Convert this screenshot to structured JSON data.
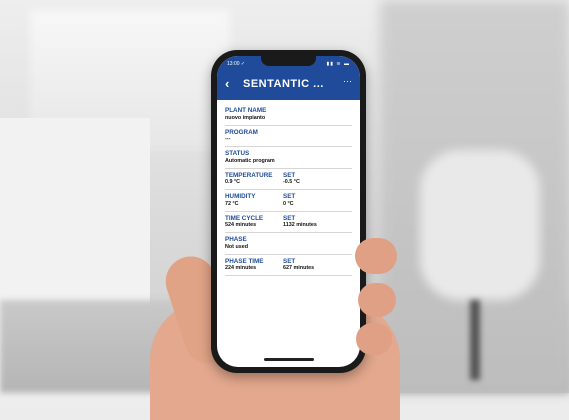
{
  "status_bar": {
    "time": "13:00 ✓",
    "icons": "▮▮ ≋ ▬"
  },
  "header": {
    "back_icon": "back-chevron-icon",
    "title": "SENTANTIC ...",
    "menu_icon": "more-icon"
  },
  "fields": {
    "plant_name": {
      "label": "PLANT NAME",
      "value": "nuovo impianto"
    },
    "program": {
      "label": "PROGRAM",
      "value": "---"
    },
    "status": {
      "label": "STATUS",
      "value": "Automatic program"
    },
    "temperature": {
      "label": "TEMPERATURE",
      "value": "0.9 °C",
      "set_label": "SET",
      "set_value": "-0.5 °C"
    },
    "humidity": {
      "label": "HUMIDITY",
      "value": "72 °C",
      "set_label": "SET",
      "set_value": "0 °C"
    },
    "time_cycle": {
      "label": "TIME CYCLE",
      "value": "524 minutes",
      "set_label": "SET",
      "set_value": "1132 minutes"
    },
    "phase": {
      "label": "PHASE",
      "value": "Not used"
    },
    "phase_time": {
      "label": "PHASE TIME",
      "value": "224 minutes",
      "set_label": "SET",
      "set_value": "627 minutes"
    }
  },
  "colors": {
    "appbar": "#1f4b9a",
    "label": "#1f4b9a"
  }
}
